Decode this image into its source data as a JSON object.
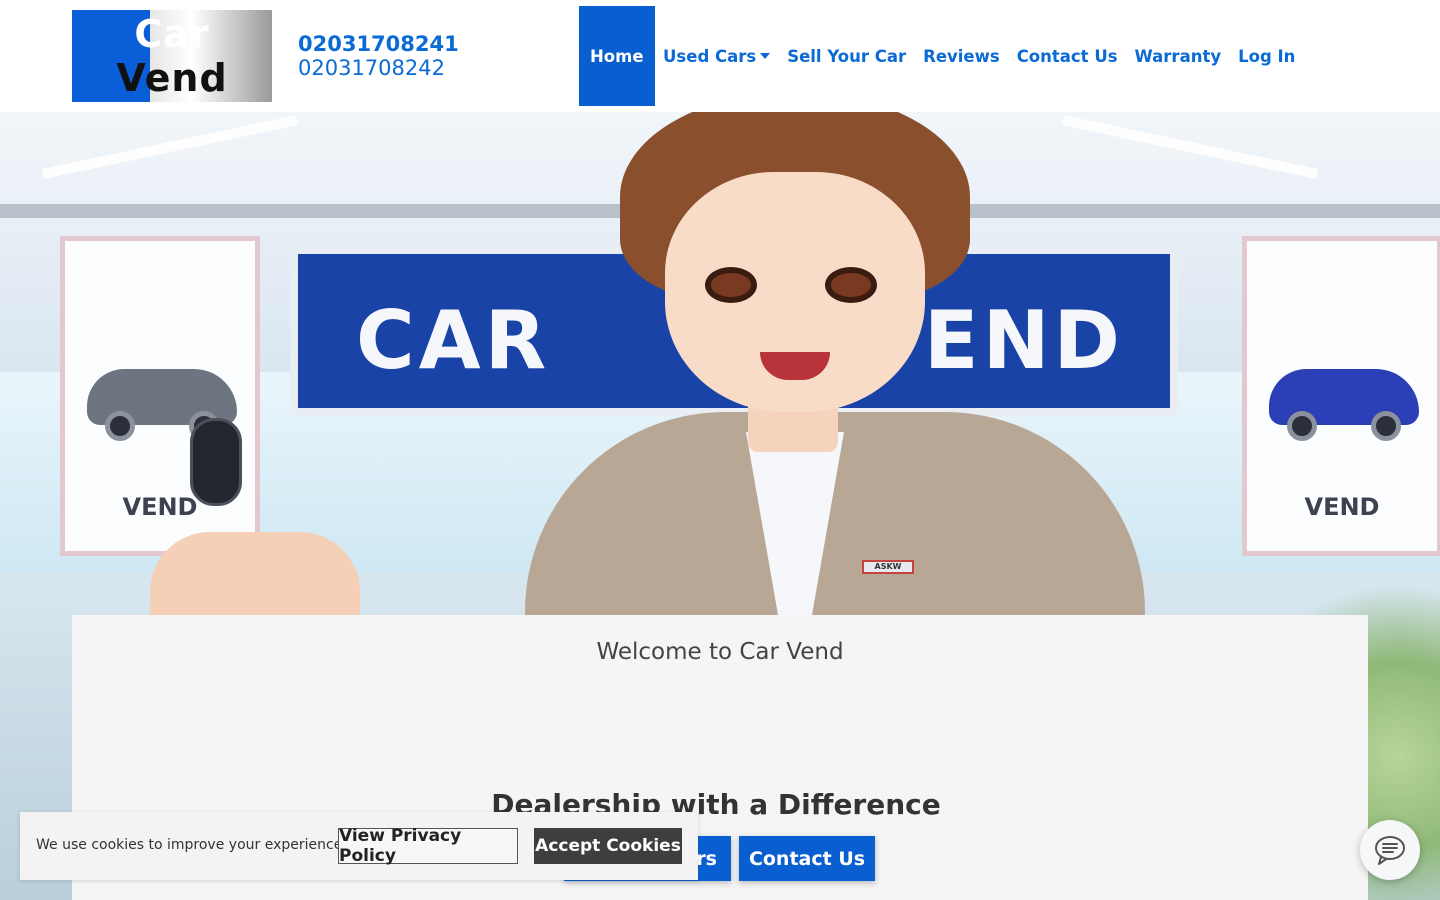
{
  "brand": {
    "logo_word1": "Car",
    "logo_word2": "Vend",
    "primary_color": "#0a5fd0",
    "link_color": "#0a6ad6"
  },
  "header": {
    "phone_primary": "02031708241",
    "phone_secondary": "02031708242"
  },
  "nav": {
    "items": [
      {
        "label": "Home",
        "active": true
      },
      {
        "label": "Used Cars",
        "has_dropdown": true
      },
      {
        "label": "Sell Your Car"
      },
      {
        "label": "Reviews"
      },
      {
        "label": "Contact Us"
      },
      {
        "label": "Warranty"
      },
      {
        "label": "Log In"
      }
    ],
    "dropdown_icon": "caret-down-icon"
  },
  "hero": {
    "sign_text_left": "CAR",
    "sign_text_right": "VEND",
    "banner_left_label": "VEND",
    "banner_right_label": "VEND",
    "badge_text": "ASKW"
  },
  "main": {
    "welcome_title": "Welcome to Car Vend",
    "tagline": "Dealership with a Difference",
    "cta_cars_label": "rs",
    "cta_contact_label": "Contact Us"
  },
  "cookie_bar": {
    "message": "We use cookies to improve your experience.",
    "privacy_label": "View Privacy Policy",
    "accept_label": "Accept Cookies"
  },
  "chat_widget": {
    "icon": "chat-bubble-icon"
  }
}
